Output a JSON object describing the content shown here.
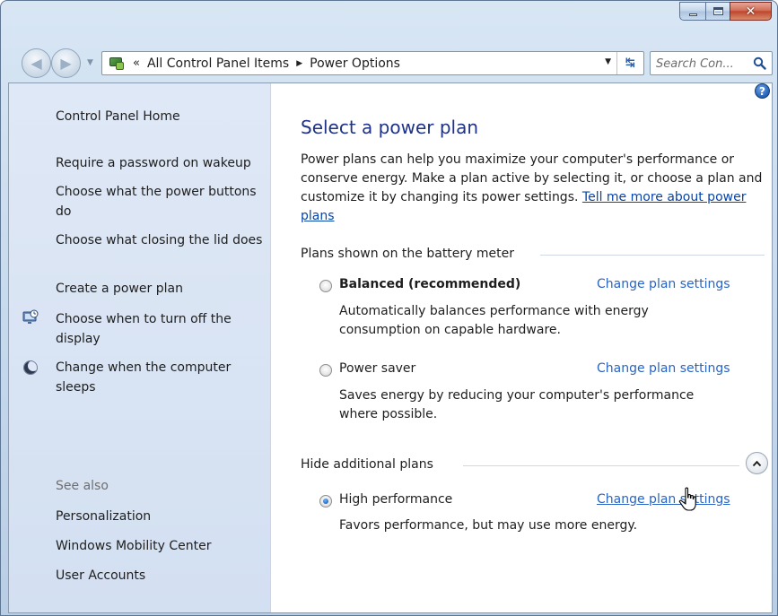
{
  "window": {
    "caption_minimize": "minimize",
    "caption_maximize": "maximize",
    "caption_close": "close"
  },
  "navbar": {
    "overflow_marker": "«",
    "breadcrumbs": [
      "All Control Panel Items",
      "Power Options"
    ],
    "search_placeholder": "Search Con..."
  },
  "sidebar": {
    "links": [
      {
        "label": "Control Panel Home"
      },
      {
        "label": "Require a password on wakeup"
      },
      {
        "label": "Choose what the power buttons do"
      },
      {
        "label": "Choose what closing the lid does"
      },
      {
        "label": "Create a power plan"
      },
      {
        "label": "Choose when to turn off the display",
        "icon": "display-clock-icon"
      },
      {
        "label": "Change when the computer sleeps",
        "icon": "moon-icon"
      }
    ],
    "see_also_heading": "See also",
    "see_also": [
      {
        "label": "Personalization"
      },
      {
        "label": "Windows Mobility Center"
      },
      {
        "label": "User Accounts"
      }
    ]
  },
  "main": {
    "title": "Select a power plan",
    "intro_text": "Power plans can help you maximize your computer's performance or conserve energy. Make a plan active by selecting it, or choose a plan and customize it by changing its power settings. ",
    "intro_link": "Tell me more about power plans",
    "group_battery_meter": "Plans shown on the battery meter",
    "group_additional": "Hide additional plans",
    "plans": [
      {
        "name": "Balanced (recommended)",
        "description": "Automatically balances performance with energy consumption on capable hardware.",
        "link": "Change plan settings",
        "selected": false
      },
      {
        "name": "Power saver",
        "description": "Saves energy by reducing your computer's performance where possible.",
        "link": "Change plan settings",
        "selected": false
      },
      {
        "name": "High performance",
        "description": "Favors performance, but may use more energy.",
        "link": "Change plan settings",
        "selected": true
      }
    ]
  },
  "colors": {
    "title_blue": "#1e3287",
    "link_blue": "#2a64c5",
    "sidebar_bg": "#dfe8f6"
  }
}
